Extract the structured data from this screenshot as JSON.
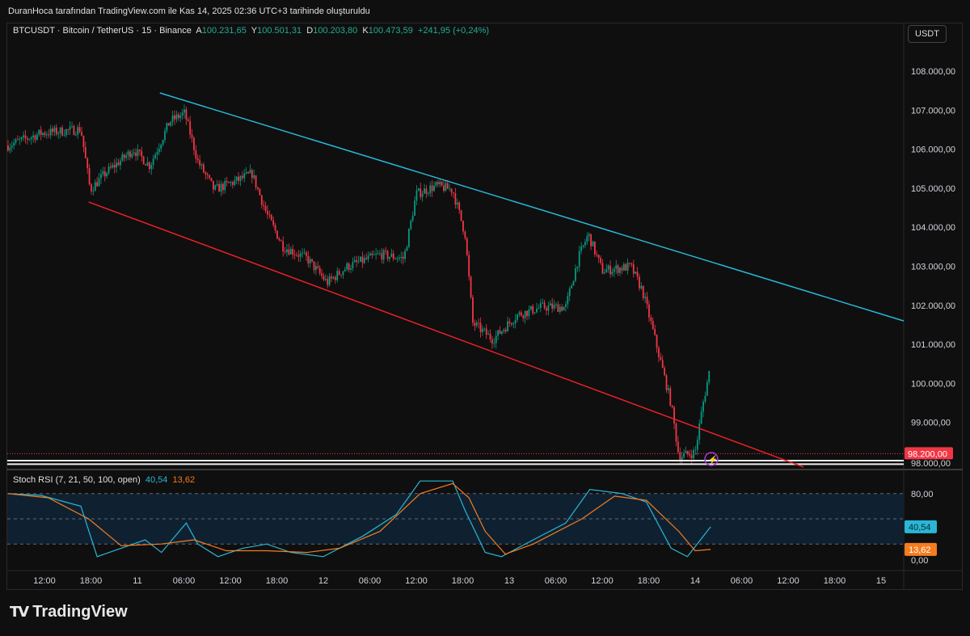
{
  "header": {
    "caption": "DuranHoca tarafından TradingView.com ile Kas 14, 2025 02:36 UTC+3 tarihinde oluşturuldu"
  },
  "legend": {
    "symbol": "BTCUSDT · Bitcoin / TetherUS · 15 · Binance",
    "o_label": "A",
    "o": "100.231,65",
    "h_label": "Y",
    "h": "100.501,31",
    "l_label": "D",
    "l": "100.203,80",
    "c_label": "K",
    "c": "100.473,59",
    "change": "+241,95 (+0,24%)"
  },
  "currency": "USDT",
  "rsi_legend": {
    "name": "Stoch RSI (7, 21, 50, 100, open)",
    "k": "40,54",
    "d": "13,62"
  },
  "logo": "TradingView",
  "colors": {
    "up": "#089981",
    "down": "#f23645",
    "channel_top": "#29b6d6",
    "channel_bottom": "#e8202a",
    "k": "#29b6d6",
    "d": "#f57c1f"
  },
  "chart_data": [
    {
      "type": "candlestick",
      "interval": "15m",
      "x_unit": "hours since 10 Nov 00:00",
      "price_path": [
        [
          7.3,
          106096
        ],
        [
          11.5,
          106406
        ],
        [
          16.7,
          106510
        ],
        [
          17.9,
          104957
        ],
        [
          19.8,
          105371
        ],
        [
          23.5,
          105992
        ],
        [
          25.6,
          105578
        ],
        [
          28.2,
          106717
        ],
        [
          30.1,
          106924
        ],
        [
          31.8,
          105682
        ],
        [
          33.9,
          104957
        ],
        [
          36.5,
          105164
        ],
        [
          38.8,
          105371
        ],
        [
          40.7,
          104336
        ],
        [
          42.8,
          103508
        ],
        [
          45.9,
          103198
        ],
        [
          48.5,
          102577
        ],
        [
          51.1,
          102993
        ],
        [
          55.3,
          103302
        ],
        [
          58.4,
          103198
        ],
        [
          60,
          104854
        ],
        [
          62.6,
          105061
        ],
        [
          64.7,
          104957
        ],
        [
          66.3,
          103819
        ],
        [
          67.3,
          101542
        ],
        [
          69.9,
          101126
        ],
        [
          73,
          101749
        ],
        [
          76.2,
          101956
        ],
        [
          79.3,
          101956
        ],
        [
          80.9,
          103198
        ],
        [
          82.2,
          103819
        ],
        [
          84,
          102887
        ],
        [
          87.7,
          102993
        ],
        [
          89.2,
          102370
        ],
        [
          90.3,
          101542
        ],
        [
          92.9,
          99472
        ],
        [
          93.9,
          98126
        ],
        [
          96,
          98230
        ],
        [
          97,
          99472
        ],
        [
          98,
          100473
        ]
      ],
      "y_ticks": [
        "108.000,00",
        "107.000,00",
        "106.000,00",
        "105.000,00",
        "104.000,00",
        "103.000,00",
        "102.000,00",
        "101.000,00",
        "100.000,00",
        "99.000,00",
        "98.000,00"
      ],
      "y_tick_values": [
        108000,
        107000,
        106000,
        105000,
        104000,
        103000,
        102000,
        101000,
        100000,
        99000,
        98000
      ],
      "price_label": "98.200,00",
      "price_label_value": 98200,
      "x_ticks": [
        "12:00",
        "18:00",
        "11",
        "06:00",
        "12:00",
        "18:00",
        "12",
        "06:00",
        "12:00",
        "18:00",
        "13",
        "06:00",
        "12:00",
        "18:00",
        "14",
        "06:00",
        "12:00",
        "18:00",
        "15"
      ],
      "trendlines": [
        {
          "name": "channel-top",
          "from": [
            26.9,
            107441
          ],
          "to": [
            123.2,
            101583
          ]
        },
        {
          "name": "channel-bottom",
          "from": [
            17.7,
            104647
          ],
          "to": [
            110,
            97857
          ]
        }
      ],
      "horizontal": [
        98020,
        97930
      ]
    },
    {
      "type": "line",
      "title": "Stoch RSI",
      "ylim": [
        0,
        100
      ],
      "y_ticks": [
        "80,00",
        "0,00"
      ],
      "bands": [
        80,
        50,
        20
      ],
      "series": [
        {
          "name": "K",
          "last": "40,54",
          "points": [
            [
              7.3,
              80
            ],
            [
              11.5,
              78
            ],
            [
              16.7,
              65
            ],
            [
              18.8,
              5
            ],
            [
              21.9,
              15
            ],
            [
              25,
              25
            ],
            [
              27.1,
              10
            ],
            [
              30.3,
              45
            ],
            [
              31.8,
              20
            ],
            [
              34.4,
              5
            ],
            [
              37.6,
              15
            ],
            [
              40.7,
              20
            ],
            [
              43.8,
              10
            ],
            [
              48,
              5
            ],
            [
              53.2,
              30
            ],
            [
              57.4,
              55
            ],
            [
              60.5,
              95
            ],
            [
              64.7,
              95
            ],
            [
              66.3,
              60
            ],
            [
              68.9,
              10
            ],
            [
              71,
              5
            ],
            [
              75.1,
              25
            ],
            [
              79.3,
              45
            ],
            [
              82.4,
              85
            ],
            [
              86.6,
              80
            ],
            [
              89.7,
              70
            ],
            [
              92.9,
              15
            ],
            [
              95,
              5
            ],
            [
              98,
              40.5
            ]
          ]
        },
        {
          "name": "D",
          "last": "13,62",
          "points": [
            [
              7.3,
              80
            ],
            [
              12.5,
              75
            ],
            [
              17.7,
              50
            ],
            [
              21.9,
              18
            ],
            [
              27.1,
              20
            ],
            [
              31.3,
              25
            ],
            [
              35.5,
              12
            ],
            [
              40.7,
              12
            ],
            [
              45.9,
              10
            ],
            [
              50.1,
              15
            ],
            [
              55.3,
              35
            ],
            [
              60.5,
              80
            ],
            [
              64.7,
              92
            ],
            [
              66.8,
              75
            ],
            [
              68.9,
              35
            ],
            [
              71.5,
              8
            ],
            [
              75.1,
              20
            ],
            [
              81.4,
              50
            ],
            [
              85.6,
              77
            ],
            [
              89.7,
              72
            ],
            [
              93.9,
              35
            ],
            [
              96,
              12
            ],
            [
              98,
              13.6
            ]
          ]
        }
      ]
    }
  ]
}
